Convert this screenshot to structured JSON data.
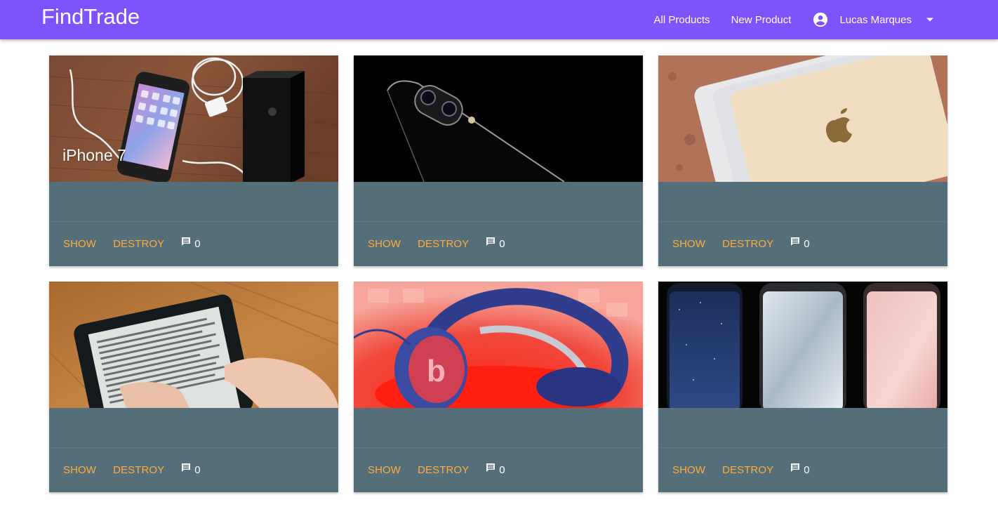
{
  "navbar": {
    "brand": "FindTrade",
    "links": {
      "all_products": "All Products",
      "new_product": "New Product"
    },
    "user": {
      "name": "Lucas Marques",
      "avatar_icon": "account-circle-icon",
      "caret_icon": "arrow-drop-down-icon"
    },
    "color": "#7e53fb"
  },
  "products": [
    {
      "title": "iPhone 7",
      "image": "iphone-box-with-accessories-photo",
      "show": "SHOW",
      "destroy": "DESTROY",
      "comments": "0"
    },
    {
      "title": "",
      "image": "jet-black-iphone-camera-photo",
      "show": "SHOW",
      "destroy": "DESTROY",
      "comments": "0"
    },
    {
      "title": "",
      "image": "stacked-macbooks-photo",
      "show": "SHOW",
      "destroy": "DESTROY",
      "comments": "0"
    },
    {
      "title": "",
      "image": "kindle-ereader-photo",
      "show": "SHOW",
      "destroy": "DESTROY",
      "comments": "0"
    },
    {
      "title": "",
      "image": "beats-headphones-photo",
      "show": "SHOW",
      "destroy": "DESTROY",
      "comments": "0"
    },
    {
      "title": "",
      "image": "galaxy-s8-phones-photo",
      "show": "SHOW",
      "destroy": "DESTROY",
      "comments": "0"
    }
  ],
  "colors": {
    "card": "#546e7a",
    "action": "#ffab40",
    "comment_icon": "comment-icon"
  }
}
